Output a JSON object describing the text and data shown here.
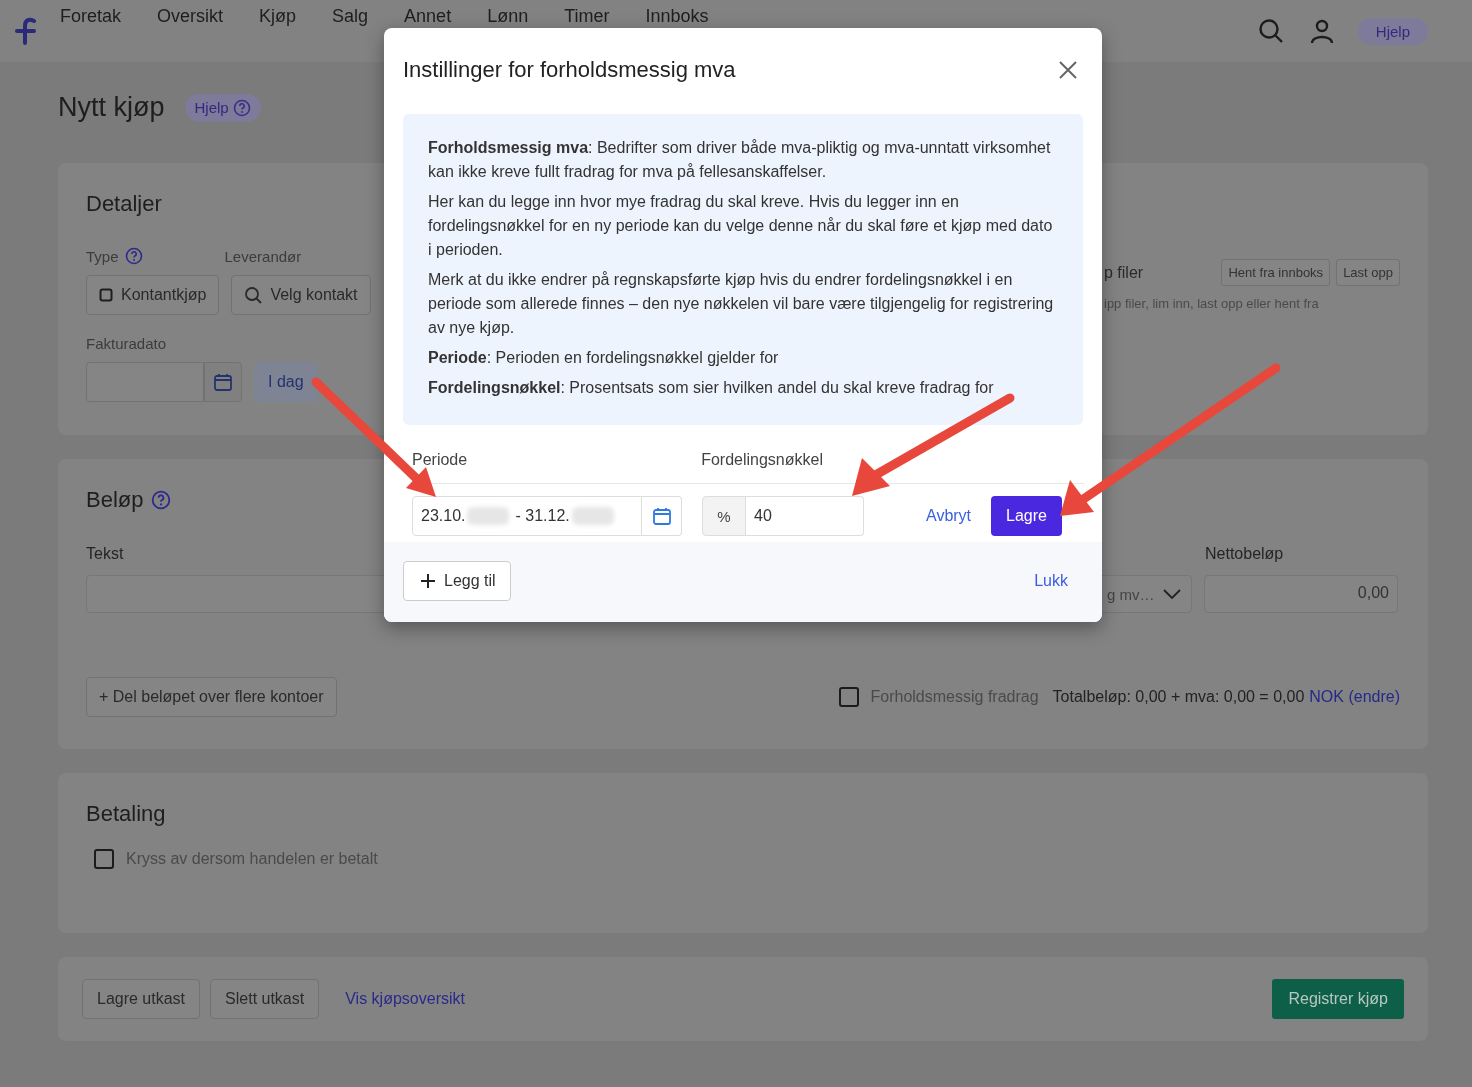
{
  "nav": {
    "items": [
      "Foretak",
      "Oversikt",
      "Kjøp",
      "Salg",
      "Annet",
      "Lønn",
      "Timer",
      "Innboks"
    ],
    "help": "Hjelp"
  },
  "page": {
    "title": "Nytt kjøp",
    "help": "Hjelp"
  },
  "details": {
    "title": "Detaljer",
    "type_label": "Type",
    "supplier_label": "Leverandør",
    "type_button": "Kontantkjøp",
    "supplier_button": "Velg kontakt",
    "invoice_date_label": "Fakturadato",
    "today_button": "I dag",
    "files_label": "p filer",
    "inbox_button": "Hent fra innboks",
    "upload_button": "Last opp",
    "files_hint": "ipp filer, lim inn, last opp eller hent fra"
  },
  "amount": {
    "title": "Beløp",
    "text_label": "Tekst",
    "vat_select": "g mv…",
    "net_label": "Nettobeløp",
    "net_value": "0,00",
    "split_button": "+ Del beløpet over flere kontoer",
    "proportional": {
      "label": "Forholdsmessig fradrag",
      "checked": false
    },
    "total": "Totalbeløp: 0,00 + mva: 0,00 = 0,00",
    "currency_link": "NOK (endre)"
  },
  "payment": {
    "title": "Betaling",
    "paid": {
      "label": "Kryss av dersom handelen er betalt",
      "checked": false
    }
  },
  "footer": {
    "buttons": [
      "Lagre utkast",
      "Slett utkast"
    ],
    "link": "Vis kjøpsoversikt",
    "primary": "Registrer kjøp"
  },
  "modal": {
    "title": "Instillinger for forholdsmessig mva",
    "info": [
      "**Forholdsmessig mva**: Bedrifter som driver både mva-pliktig og mva-unntatt virksomhet kan ikke kreve fullt fradrag for mva på fellesanskaffelser.",
      "Her kan du legge inn hvor mye fradrag du skal kreve. Hvis du legger inn en fordelingsnøkkel for en ny periode kan du velge denne når du skal føre et kjøp med dato i perioden.",
      "Merk at du ikke endrer på regnskapsførte kjøp hvis du endrer fordelingsnøkkel i en periode som allerede finnes – den nye nøkkelen vil bare være tilgjengelig for registrering av nye kjøp.",
      "**Periode**: Perioden en fordelingsnøkkel gjelder for",
      "**Fordelingsnøkkel**: Prosentsats som sier hvilken andel du skal kreve fradrag for"
    ],
    "period_label": "Periode",
    "key_label": "Fordelingsnøkkel",
    "period_start": "23.10.",
    "period_end": "- 31.12.",
    "percent": "%",
    "key_value": "40",
    "cancel": "Avbryt",
    "save": "Lagre",
    "add": "Legg til",
    "close_link": "Lukk"
  }
}
